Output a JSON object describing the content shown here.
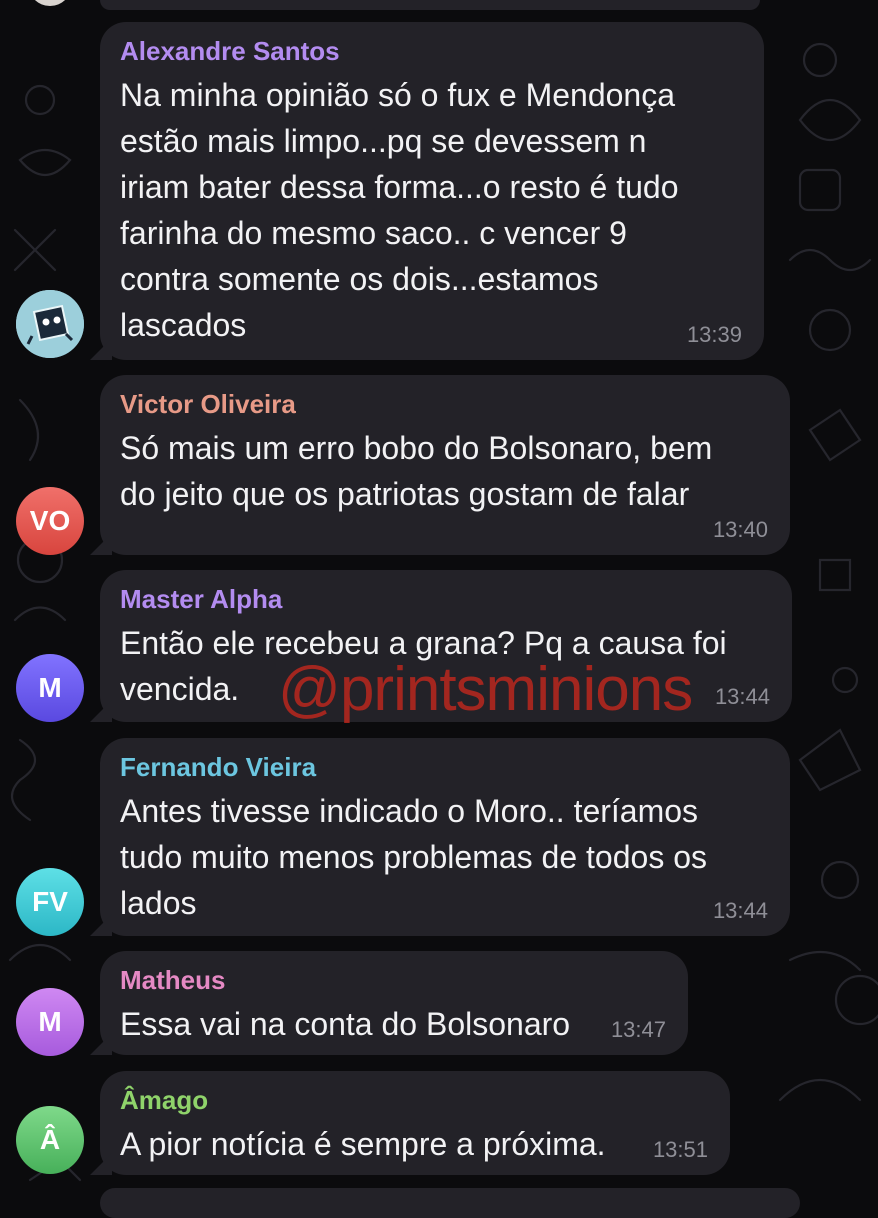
{
  "watermark": "@printsminions",
  "colors": {
    "background": "#0b0b0d",
    "bubble": "#232228",
    "text": "#f2f2f4",
    "time": "#8f8f97"
  },
  "messages": [
    {
      "sender": "Alexandre Santos",
      "sender_color": "#b38cf0",
      "text": "Na minha opinião  só  o fux e Mendonça\nestão mais limpo...pq se devessem n\niriam bater dessa forma...o resto é tudo\nfarinha do mesmo saco.. c vencer 9\ncontra somente os dois...estamos\nlascados",
      "time": "13:39",
      "avatar": {
        "type": "image",
        "icon": "robot-sticker-icon"
      }
    },
    {
      "sender": "Victor Oliveira",
      "sender_color": "#e79a87",
      "text": "Só mais um erro bobo do Bolsonaro, bem\ndo jeito que os patriotas gostam de falar",
      "time": "13:40",
      "avatar": {
        "type": "initials",
        "initials": "VO",
        "color": "#e0564a"
      }
    },
    {
      "sender": "Master Alpha",
      "sender_color": "#b38cf0",
      "text": "Então ele recebeu a grana? Pq a causa foi\nvencida.",
      "time": "13:44",
      "avatar": {
        "type": "initials",
        "initials": "M",
        "color": "#6b5bf0"
      }
    },
    {
      "sender": "Fernando Vieira",
      "sender_color": "#6cc6e0",
      "text": "Antes tivesse indicado o Moro.. teríamos\ntudo muito menos problemas de todos os\nlados",
      "time": "13:44",
      "avatar": {
        "type": "initials",
        "initials": "FV",
        "color": "#3ccbd6"
      }
    },
    {
      "sender": "Matheus",
      "sender_color": "#e589c4",
      "text": "Essa vai na conta do Bolsonaro",
      "time": "13:47",
      "avatar": {
        "type": "initials",
        "initials": "M",
        "color": "#b96ee0"
      }
    },
    {
      "sender": "Âmago",
      "sender_color": "#8fd36a",
      "text": "A pior notícia é sempre a próxima.",
      "time": "13:51",
      "avatar": {
        "type": "initials",
        "initials": "Â",
        "color": "#5fbf6a"
      }
    }
  ]
}
